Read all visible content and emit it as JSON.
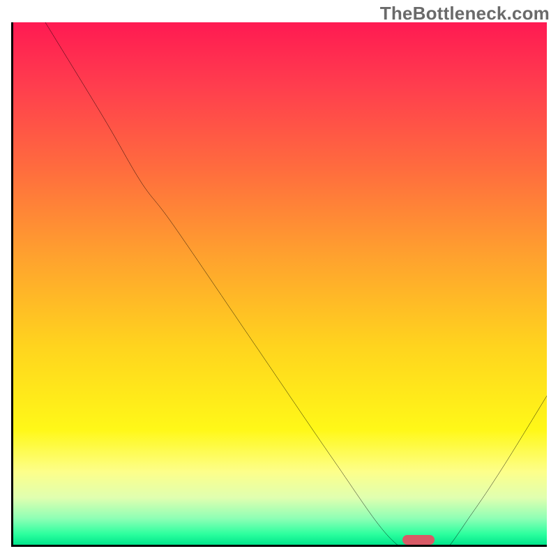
{
  "watermark": "TheBottleneck.com",
  "marker": {
    "x_pct": 73,
    "width_pct": 6,
    "color": "#d85a66"
  },
  "chart_data": {
    "type": "line",
    "title": "",
    "xlabel": "",
    "ylabel": "",
    "xlim": [
      0,
      100
    ],
    "ylim": [
      0,
      100
    ],
    "grid": false,
    "legend": false,
    "background": "red-yellow-green vertical gradient (red at top, green at bottom)",
    "series": [
      {
        "name": "bottleneck-curve",
        "x": [
          6,
          17,
          24,
          30,
          45,
          60,
          70,
          76,
          80,
          86,
          92,
          100
        ],
        "values": [
          100,
          82,
          70,
          62,
          40,
          18,
          4,
          0,
          0,
          8,
          17,
          30
        ]
      }
    ],
    "optimal_marker": {
      "x_start_pct": 73,
      "x_end_pct": 79,
      "y_pct": 0
    },
    "colors": {
      "curve": "#000000",
      "marker": "#d85a66",
      "axis": "#000000",
      "gradient_top": "#ff1a52",
      "gradient_mid": "#ffd41e",
      "gradient_bottom": "#00e58b"
    }
  }
}
